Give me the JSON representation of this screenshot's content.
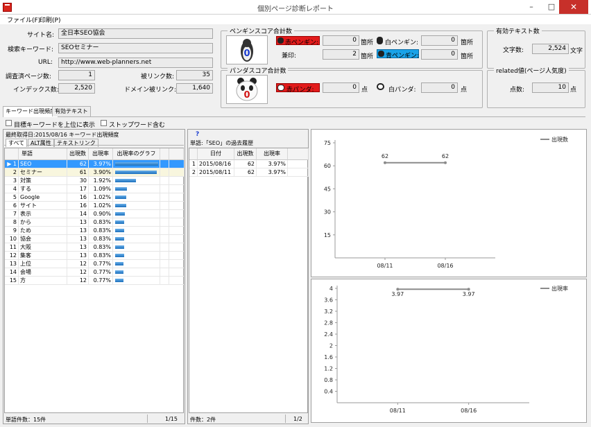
{
  "window": {
    "title": "個別ページ診断レポート",
    "min": "–",
    "max": "□",
    "close": "✕"
  },
  "menu": {
    "file": "ファイル(F)",
    "print": "印刷(P)"
  },
  "site": {
    "site_name_label": "サイト名:",
    "site_name": "全日本SEO協会",
    "keyword_label": "検索キーワード:",
    "keyword": "SEOセミナー",
    "url_label": "URL:",
    "url": "http://www.web-planners.net",
    "pages_label": "調査済ページ数:",
    "pages": "1",
    "backlinks_label": "被リンク数:",
    "backlinks": "35",
    "index_label": "インデックス数:",
    "index": "2,520",
    "domain_backlinks_label": "ドメイン被リンク:",
    "domain_backlinks": "1,640"
  },
  "penguin": {
    "title": "ペンギンスコア合計数",
    "red_label": "赤ペンギン:",
    "red": "0",
    "red_unit": "箇所",
    "white_label": "白ペンギン:",
    "white": "0",
    "white_unit": "箇所",
    "mark_label": "兼印:",
    "mark": "2",
    "mark_unit": "箇所",
    "blue_label": "青ペンギン:",
    "blue": "0",
    "blue_unit": "箇所",
    "score": "0"
  },
  "panda": {
    "title": "パンダスコア合計数",
    "red_label": "赤パンダ:",
    "red": "0",
    "red_unit": "点",
    "white_label": "白パンダ:",
    "white": "0",
    "white_unit": "点",
    "score": "0"
  },
  "text_count": {
    "title": "有効テキスト数",
    "label": "文字数:",
    "value": "2,524",
    "unit": "文字"
  },
  "related": {
    "title": "related値(ページ人気度)",
    "label": "点数:",
    "value": "10",
    "unit": "点"
  },
  "tabs": [
    "キーワード出現頻度",
    "有効テキスト"
  ],
  "options": {
    "top_keyword": "目標キーワードを上位に表示",
    "stopword": "ストップワード含む"
  },
  "freq": {
    "header": "最終取得日:2015/08/16 キーワード出現頻度",
    "subtabs": [
      "すべて",
      "ALT属性",
      "テキストリンク"
    ],
    "columns": [
      "単語",
      "出現数",
      "出現率",
      "出現率のグラフ"
    ],
    "rows": [
      {
        "no": "1",
        "word": "SEO",
        "count": "62",
        "rate": "3.97%",
        "pct": 3.97
      },
      {
        "no": "2",
        "word": "セミナー",
        "count": "61",
        "rate": "3.90%",
        "pct": 3.9
      },
      {
        "no": "3",
        "word": "対策",
        "count": "30",
        "rate": "1.92%",
        "pct": 1.92
      },
      {
        "no": "4",
        "word": "する",
        "count": "17",
        "rate": "1.09%",
        "pct": 1.09
      },
      {
        "no": "5",
        "word": "Google",
        "count": "16",
        "rate": "1.02%",
        "pct": 1.02
      },
      {
        "no": "6",
        "word": "サイト",
        "count": "16",
        "rate": "1.02%",
        "pct": 1.02
      },
      {
        "no": "7",
        "word": "表示",
        "count": "14",
        "rate": "0.90%",
        "pct": 0.9
      },
      {
        "no": "8",
        "word": "から",
        "count": "13",
        "rate": "0.83%",
        "pct": 0.83
      },
      {
        "no": "9",
        "word": "ため",
        "count": "13",
        "rate": "0.83%",
        "pct": 0.83
      },
      {
        "no": "10",
        "word": "協会",
        "count": "13",
        "rate": "0.83%",
        "pct": 0.83
      },
      {
        "no": "11",
        "word": "大阪",
        "count": "13",
        "rate": "0.83%",
        "pct": 0.83
      },
      {
        "no": "12",
        "word": "集客",
        "count": "13",
        "rate": "0.83%",
        "pct": 0.83
      },
      {
        "no": "13",
        "word": "上位",
        "count": "12",
        "rate": "0.77%",
        "pct": 0.77
      },
      {
        "no": "14",
        "word": "会場",
        "count": "12",
        "rate": "0.77%",
        "pct": 0.77
      },
      {
        "no": "15",
        "word": "方",
        "count": "12",
        "rate": "0.77%",
        "pct": 0.77
      }
    ],
    "status_left": "単語件数：15件",
    "status_right": "1/15"
  },
  "history": {
    "help": "?",
    "title": "単語:「SEO」の過去履歴",
    "columns": [
      "日付",
      "出現数",
      "出現率"
    ],
    "rows": [
      {
        "no": "1",
        "date": "2015/08/16",
        "count": "62",
        "rate": "3.97%"
      },
      {
        "no": "2",
        "date": "2015/08/11",
        "count": "62",
        "rate": "3.97%"
      }
    ],
    "status_left": "件数：2件",
    "status_right": "1/2"
  },
  "chart_data": [
    {
      "type": "line",
      "title": "",
      "categories": [
        "08/11",
        "08/16"
      ],
      "series": [
        {
          "name": "出現数",
          "values": [
            62,
            62
          ]
        }
      ],
      "yticks": [
        15,
        30,
        45,
        60,
        75
      ],
      "ylim": [
        0,
        75
      ],
      "data_labels": [
        "62",
        "62"
      ],
      "legend": "top-right",
      "grid": false
    },
    {
      "type": "line",
      "title": "",
      "categories": [
        "08/11",
        "08/16"
      ],
      "series": [
        {
          "name": "出現率",
          "values": [
            3.97,
            3.97
          ]
        }
      ],
      "yticks": [
        0.4,
        0.8,
        1.2,
        1.6,
        2,
        2.4,
        2.8,
        3.2,
        3.6,
        4
      ],
      "ylim": [
        0,
        4
      ],
      "data_labels": [
        "3.97",
        "3.97"
      ],
      "legend": "top-right",
      "grid": false
    }
  ]
}
